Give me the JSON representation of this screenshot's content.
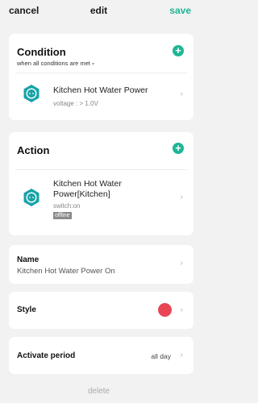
{
  "header": {
    "cancel_label": "cancel",
    "title": "edit",
    "save_label": "save"
  },
  "condition": {
    "title": "Condition",
    "mode_label": "when all conditions are met",
    "mode_caret": "▾",
    "add_symbol": "+",
    "items": [
      {
        "name": "Kitchen Hot Water Power",
        "detail": "voltage : > 1.0V"
      }
    ]
  },
  "action": {
    "title": "Action",
    "add_symbol": "+",
    "items": [
      {
        "name_line1": "Kitchen Hot Water",
        "name_line2": "Power[Kitchen]",
        "detail": "switch:on",
        "status_badge": "offline"
      }
    ]
  },
  "name_row": {
    "label": "Name",
    "value": "Kitchen Hot Water Power On"
  },
  "style_row": {
    "label": "Style",
    "color": "#e84654"
  },
  "period_row": {
    "label": "Activate period",
    "value": "all day"
  },
  "footer": {
    "delete_label": "delete"
  },
  "icons": {
    "chevron": "›",
    "device_icon": "smart-plug-icon"
  },
  "colors": {
    "accent": "#1fb597"
  }
}
